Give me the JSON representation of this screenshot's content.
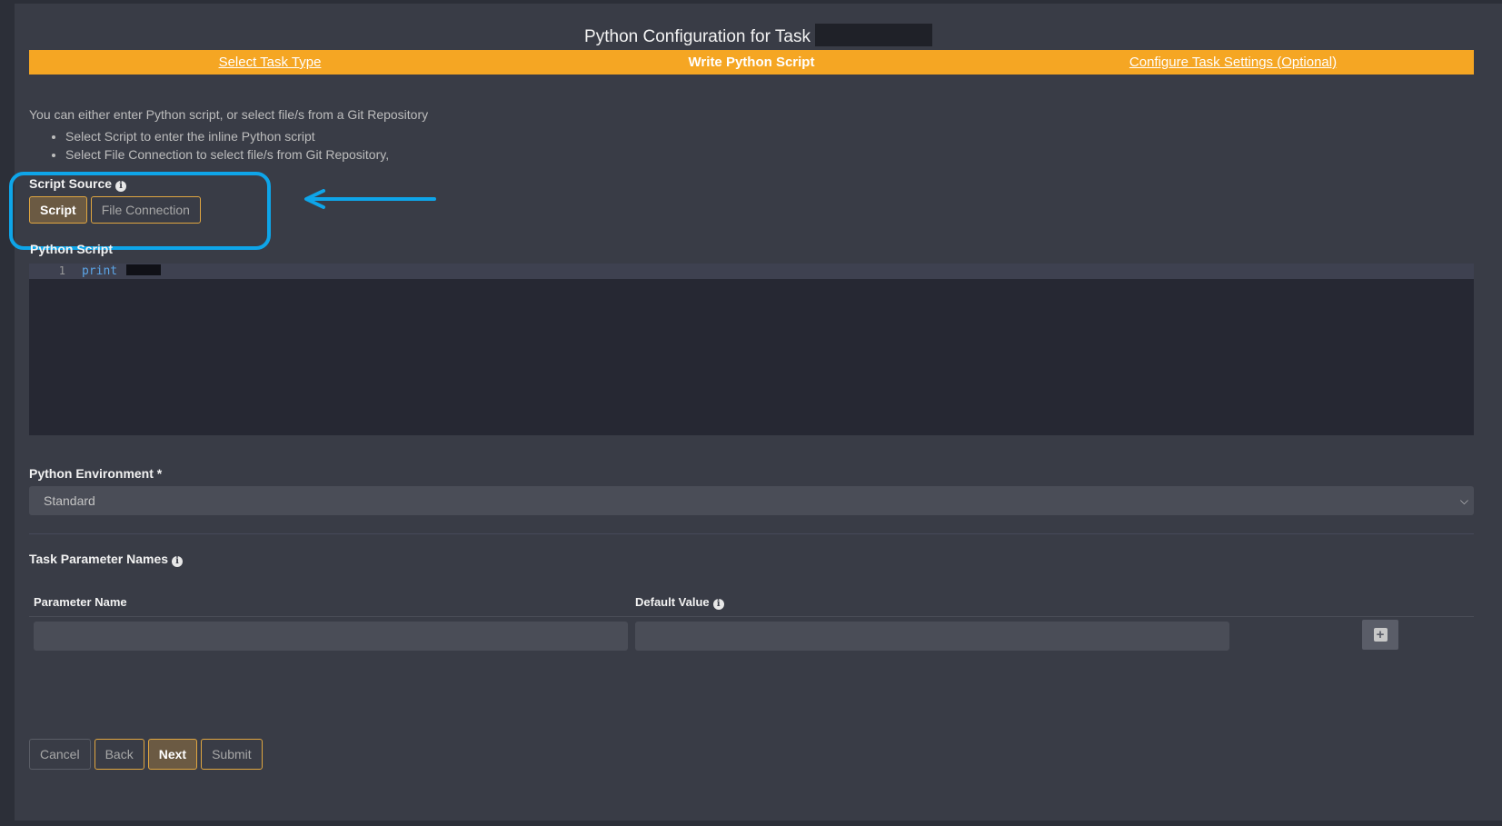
{
  "header": {
    "title": "Python Configuration for Task"
  },
  "steps": [
    {
      "label": "Select Task Type",
      "state": "link"
    },
    {
      "label": "Write Python Script",
      "state": "current"
    },
    {
      "label": "Configure Task Settings (Optional)",
      "state": "link"
    }
  ],
  "intro": {
    "text": "You can either enter Python script, or select file/s from a Git Repository",
    "bullets": [
      "Select Script to enter the inline Python script",
      "Select File Connection to select file/s from Git Repository,"
    ]
  },
  "script_source": {
    "label": "Script Source",
    "options": [
      "Script",
      "File Connection"
    ],
    "selected": "Script"
  },
  "python_script": {
    "label": "Python Script",
    "line_number": "1",
    "code": "print"
  },
  "python_environment": {
    "label": "Python Environment *",
    "value": "Standard"
  },
  "parameters": {
    "label": "Task Parameter Names",
    "col_name": "Parameter Name",
    "col_default": "Default Value"
  },
  "footer": {
    "cancel": "Cancel",
    "back": "Back",
    "next": "Next",
    "submit": "Submit"
  },
  "colors": {
    "accent": "#f5a623",
    "highlight": "#0ea5e9",
    "panel": "#393c46"
  }
}
